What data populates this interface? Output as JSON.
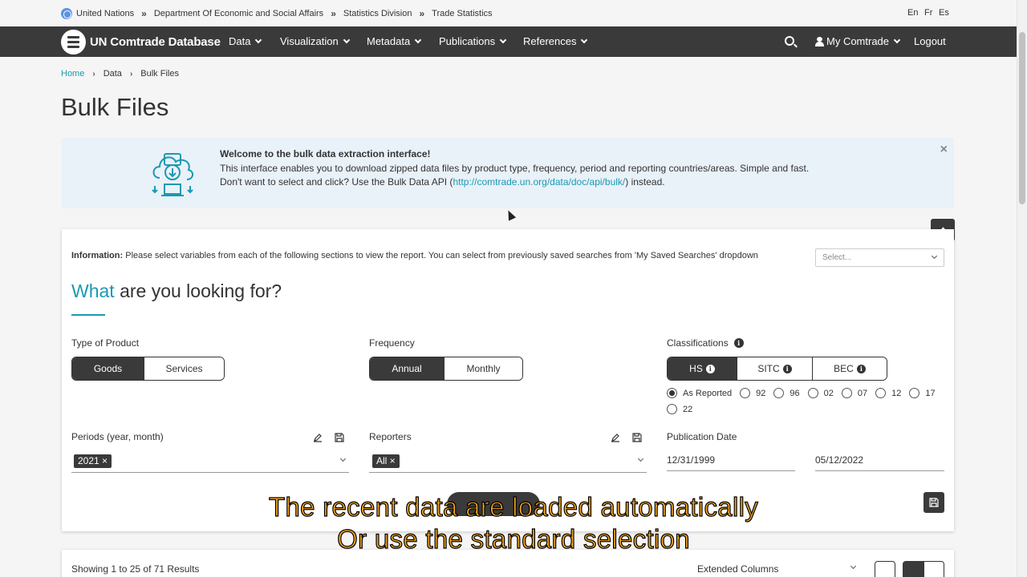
{
  "top_breadcrumb": {
    "items": [
      "United Nations",
      "Department Of Economic and Social Affairs",
      "Statistics Division",
      "Trade Statistics"
    ]
  },
  "languages": [
    "En",
    "Fr",
    "Es"
  ],
  "nav": {
    "brand": "UN Comtrade Database",
    "items": [
      "Data",
      "Visualization",
      "Metadata",
      "Publications",
      "References"
    ],
    "account": "My Comtrade",
    "logout": "Logout"
  },
  "page_breadcrumb": [
    "Home",
    "Data",
    "Bulk Files"
  ],
  "page_title": "Bulk Files",
  "banner": {
    "heading": "Welcome to the bulk data extraction interface!",
    "line1": "This interface enables you to download zipped data files by product type, frequency, period and reporting countries/areas. Simple and fast.",
    "line2_pre": "Don't want to select and click? Use the Bulk Data API (",
    "line2_link": "http://comtrade.un.org/data/doc/api/bulk/",
    "line2_post": ") instead.",
    "close": "×"
  },
  "form": {
    "info_label": "Information:",
    "info_text": "Please select variables from each of the following sections to view the report. You can select from previously saved searches from 'My Saved Searches' dropdown",
    "saved_searches_placeholder": "Select...",
    "heading_accent": "What",
    "heading_rest": "are you looking for?",
    "type_of_product": {
      "label": "Type of Product",
      "options": [
        "Goods",
        "Services"
      ],
      "selected": "Goods"
    },
    "frequency": {
      "label": "Frequency",
      "options": [
        "Annual",
        "Monthly"
      ],
      "selected": "Annual"
    },
    "classifications": {
      "label": "Classifications",
      "options": [
        "HS",
        "SITC",
        "BEC"
      ],
      "selected": "HS",
      "versions": [
        "As Reported",
        "92",
        "96",
        "02",
        "07",
        "12",
        "17",
        "22"
      ],
      "selected_version": "As Reported"
    },
    "periods": {
      "label": "Periods (year, month)",
      "chip": "2021"
    },
    "reporters": {
      "label": "Reporters",
      "chip": "All"
    },
    "publication_date": {
      "label": "Publication Date",
      "from": "12/31/1999",
      "to": "05/12/2022"
    }
  },
  "results": {
    "count_text": "Showing 1 to 25 of 71 Results",
    "columns_select": "Extended Columns"
  },
  "subtitles": [
    "The recent data are loaded automatically",
    "Or use the standard selection"
  ],
  "colors": {
    "accent": "#1a9ab0",
    "nav_bg": "#3a3a3a",
    "banner_bg": "#e9f1f9",
    "subtitle": "#f5a623"
  }
}
